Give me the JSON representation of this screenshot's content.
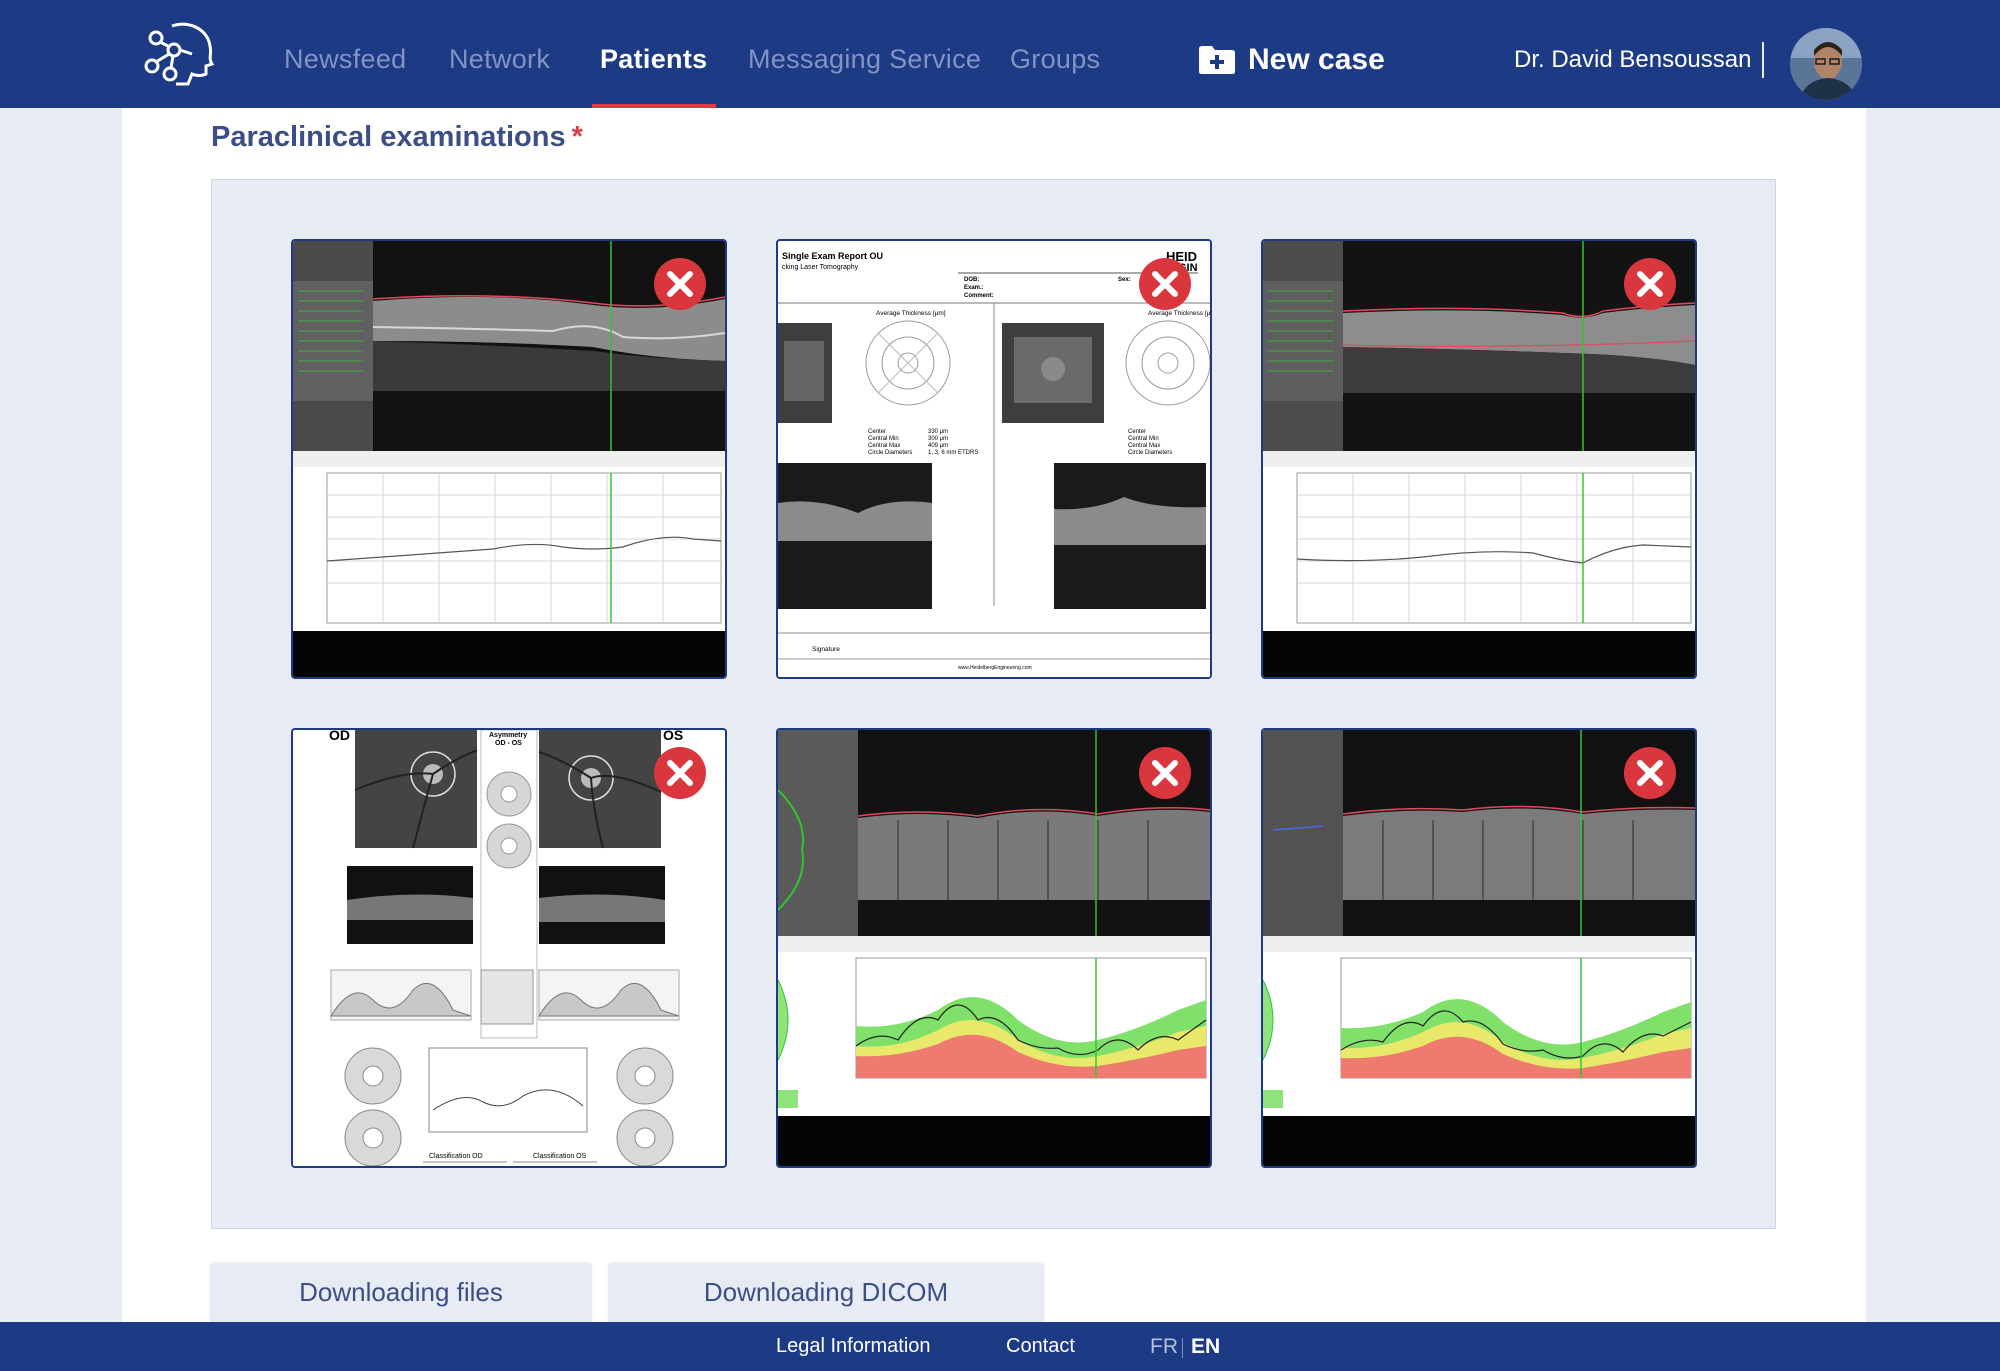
{
  "nav": {
    "items": [
      {
        "label": "Newsfeed"
      },
      {
        "label": "Network"
      },
      {
        "label": "Patients"
      },
      {
        "label": "Messaging Service"
      },
      {
        "label": "Groups"
      }
    ],
    "active": "Patients",
    "new_case_label": "New case",
    "user_name": "Dr. David Bensoussan"
  },
  "section": {
    "title": "Paraclinical examinations",
    "required_marker": "*"
  },
  "images": {
    "report": {
      "title": "Single Exam Report OU",
      "subtitle": "cking Laser Tomography",
      "brand": "HEID",
      "brand2": "GIN",
      "fields": [
        "DOB:",
        "Exam.:",
        "Comment:"
      ],
      "sex_label": "Sex:",
      "avg_thickness": "Average Thickness [μm]",
      "center_labels": [
        "Center",
        "Central Min",
        "Central Max",
        "Circle Diameters"
      ],
      "center_values": [
        "330 μm",
        "300 μm",
        "409 μm",
        "1, 3, 6 mm ETDRS"
      ],
      "signature": "Signature",
      "website": "www.HeidelbergEngineering.com"
    },
    "asymmetry": {
      "od": "OD",
      "os": "OS",
      "title": "Asymmetry",
      "subtitle": "OD - OS",
      "class_od": "Classification OD",
      "class_os": "Classification OS"
    }
  },
  "actions": {
    "download_files": "Downloading files",
    "download_dicom": "Downloading DICOM"
  },
  "footer": {
    "legal": "Legal Information",
    "contact": "Contact",
    "lang_fr": "FR",
    "lang_en": "EN"
  },
  "colors": {
    "brand": "#1d3a85",
    "accent": "#e23b3f",
    "nav_inactive": "#8494c2"
  }
}
